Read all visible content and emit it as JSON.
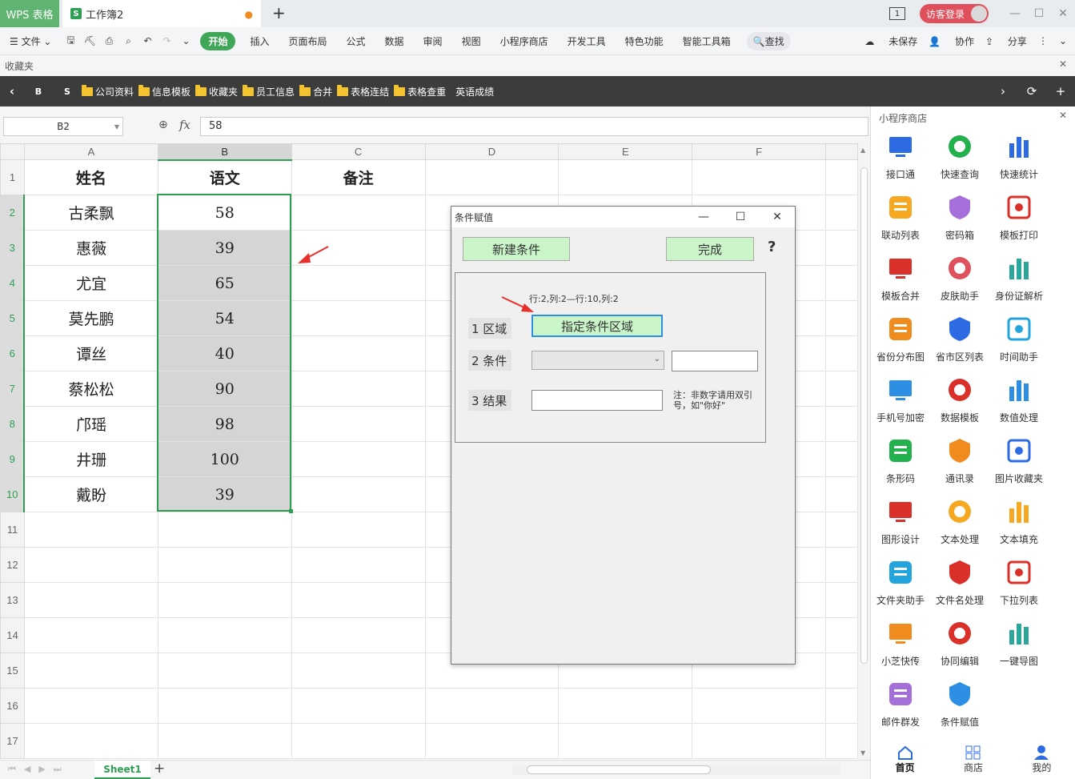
{
  "titlebar": {
    "app_tab": "WPS 表格",
    "doc_tab": "工作簿2",
    "doc_icon": "S",
    "doc_modified": "●",
    "new_tab": "+",
    "login_label": "访客登录",
    "box_num": "1"
  },
  "menubar": {
    "file": "文件",
    "start": "开始",
    "items": [
      "插入",
      "页面布局",
      "公式",
      "数据",
      "审阅",
      "视图",
      "小程序商店",
      "开发工具",
      "特色功能",
      "智能工具箱"
    ],
    "search": "查找",
    "unsaved": "未保存",
    "collab": "协作",
    "share": "分享"
  },
  "favbar": {
    "label": "收藏夹"
  },
  "bookbar": {
    "letters": [
      "B",
      "S"
    ],
    "folders": [
      "公司资料",
      "信息模板",
      "收藏夹",
      "员工信息",
      "合并",
      "表格连结",
      "表格查重"
    ],
    "plain": "英语成绩"
  },
  "formula": {
    "cell_ref": "B2",
    "fx": "fx",
    "value": "58"
  },
  "sheet": {
    "columns": [
      "A",
      "B",
      "C",
      "D",
      "E",
      "F"
    ],
    "row_numbers": [
      "1",
      "2",
      "3",
      "4",
      "5",
      "6",
      "7",
      "8",
      "9",
      "10",
      "11",
      "12",
      "13",
      "14",
      "15",
      "16",
      "17"
    ],
    "headers": [
      "姓名",
      "语文",
      "备注"
    ],
    "names": [
      "古柔飘",
      "惠薇",
      "尤宜",
      "莫先鹏",
      "谭丝",
      "蔡松松",
      "邝瑶",
      "井珊",
      "戴盼"
    ],
    "scores": [
      "58",
      "39",
      "65",
      "54",
      "40",
      "90",
      "98",
      "100",
      "39"
    ],
    "tab": "Sheet1"
  },
  "dialog": {
    "title": "条件赋值",
    "new_condition": "新建条件",
    "done": "完成",
    "help": "?",
    "range_info": "行:2,列:2—行:10,列:2",
    "label_area": "1 区域",
    "area_button": "指定条件区域",
    "label_condition": "2 条件",
    "label_result": "3 结果",
    "note": "注：非数字请用双引号，如\"你好\"",
    "note_line1": "注：非数字请用双引",
    "note_line2": "号，如\"你好\""
  },
  "panel": {
    "title": "小程序商店",
    "apps": [
      {
        "name": "接口通",
        "icon": "monitor-icon",
        "color": "#2d6be4"
      },
      {
        "name": "快速查询",
        "icon": "search-icon",
        "color": "#22b14c"
      },
      {
        "name": "快速统计",
        "icon": "bar-chart-icon",
        "color": "#2d6be4"
      },
      {
        "name": "联动列表",
        "icon": "download-list-icon",
        "color": "#f6a821"
      },
      {
        "name": "密码箱",
        "icon": "shield-key-icon",
        "color": "#a46fd8"
      },
      {
        "name": "模板打印",
        "icon": "printer-icon",
        "color": "#d9302a"
      },
      {
        "name": "模板合并",
        "icon": "merge-icon",
        "color": "#d9302a"
      },
      {
        "name": "皮肤助手",
        "icon": "shirt-icon",
        "color": "#e0505c"
      },
      {
        "name": "身份证解析",
        "icon": "id-card-icon",
        "color": "#2aa79b"
      },
      {
        "name": "省份分布图",
        "icon": "map-icon",
        "color": "#f08c1e"
      },
      {
        "name": "省市区列表",
        "icon": "location-icon",
        "color": "#2d6be4"
      },
      {
        "name": "时间助手",
        "icon": "clock-icon",
        "color": "#22a5dd"
      },
      {
        "name": "手机号加密",
        "icon": "phone-icon",
        "color": "#2d8fe4"
      },
      {
        "name": "数据模板",
        "icon": "network-icon",
        "color": "#d9302a"
      },
      {
        "name": "数值处理",
        "icon": "number-123-icon",
        "color": "#2d8fe4"
      },
      {
        "name": "条形码",
        "icon": "barcode-icon",
        "color": "#22b14c"
      },
      {
        "name": "通讯录",
        "icon": "contacts-icon",
        "color": "#f08c1e"
      },
      {
        "name": "图片收藏夹",
        "icon": "image-icon",
        "color": "#2d6be4"
      },
      {
        "name": "图形设计",
        "icon": "shapes-icon",
        "color": "#d9302a"
      },
      {
        "name": "文本处理",
        "icon": "text-t-icon",
        "color": "#f6a821"
      },
      {
        "name": "文本填充",
        "icon": "document-icon",
        "color": "#f6a821"
      },
      {
        "name": "文件夹助手",
        "icon": "folder-icon",
        "color": "#22a5dd"
      },
      {
        "name": "文件名处理",
        "icon": "files-icon",
        "color": "#d9302a"
      },
      {
        "name": "下拉列表",
        "icon": "dropdown-triangle-icon",
        "color": "#d9302a"
      },
      {
        "name": "小芝快传",
        "icon": "signal-icon",
        "color": "#f08c1e"
      },
      {
        "name": "协同编辑",
        "icon": "edit-doc-icon",
        "color": "#d9302a"
      },
      {
        "name": "一键导图",
        "icon": "picture-export-icon",
        "color": "#2aa79b"
      },
      {
        "name": "邮件群发",
        "icon": "mail-icon",
        "color": "#a46fd8"
      },
      {
        "name": "条件赋值",
        "icon": "if-icon",
        "color": "#2d8fe4"
      }
    ],
    "bottom": [
      "首页",
      "商店",
      "我的"
    ]
  }
}
